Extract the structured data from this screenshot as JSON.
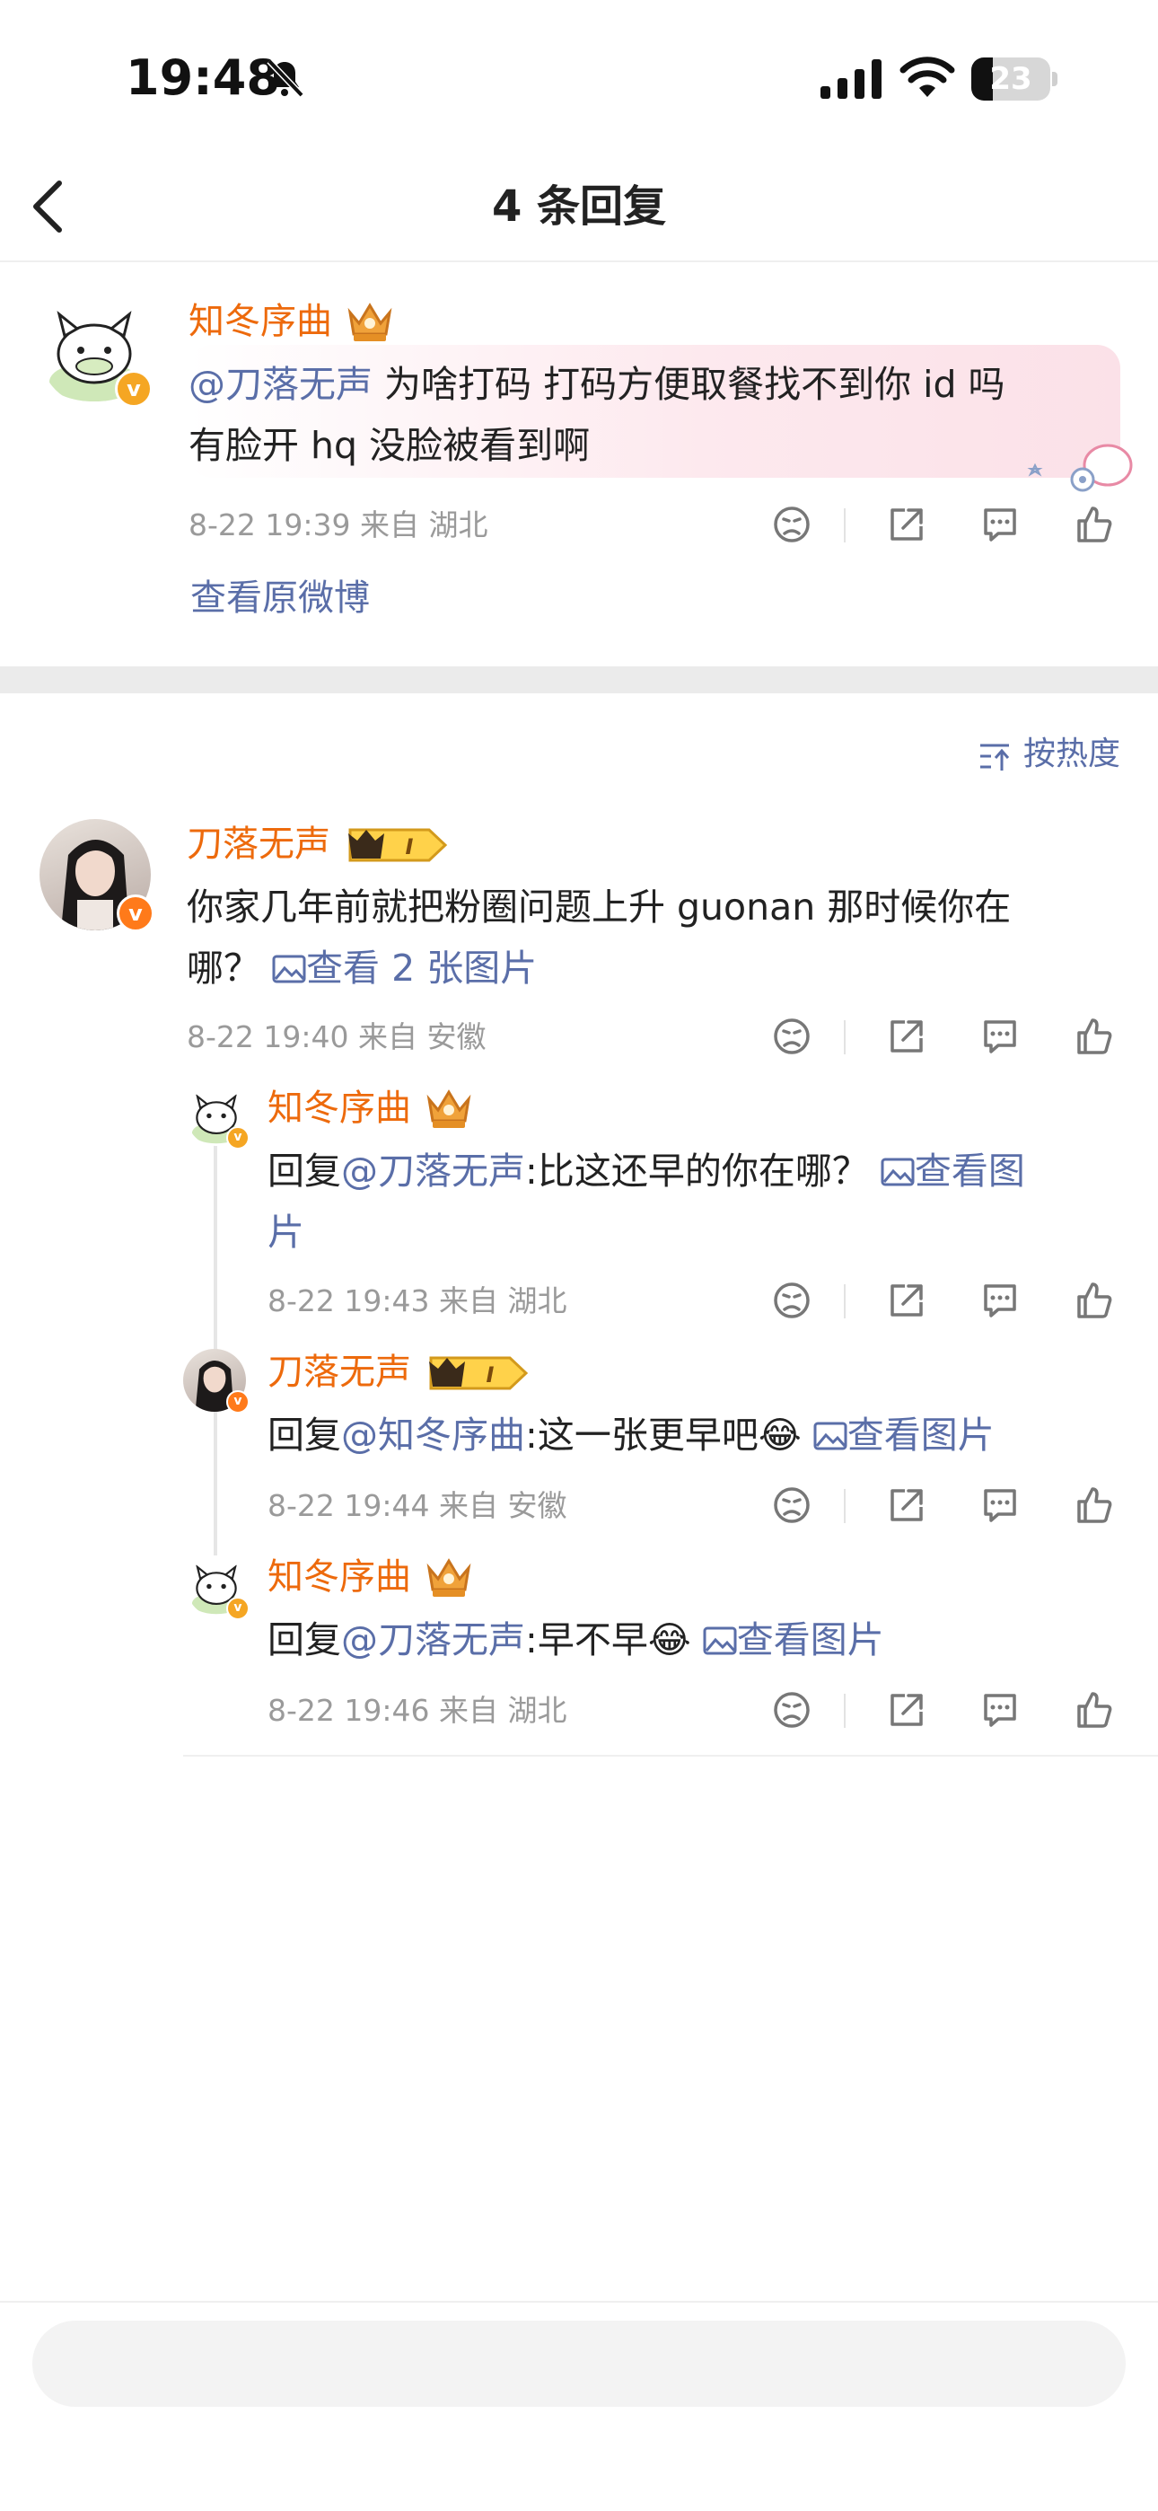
{
  "status_bar": {
    "time": "19:48",
    "battery": "23"
  },
  "nav": {
    "title": "4 条回复"
  },
  "root": {
    "user": "知冬序曲",
    "mention": "@刀落无声",
    "text_line1": " 为啥打码 打码方便取餐找不到你 id 吗",
    "text_line2": "有脸开 hq 没脸被看到啊",
    "meta": "8-22 19:39  来自 湖北",
    "view_original": "查看原微博"
  },
  "sort_label": "按热度",
  "comment": {
    "user": "刀落无声",
    "level": "I",
    "text_line1": "你家几年前就把粉圈问题上升 guonan 那时候你在",
    "text_line2": "哪？",
    "image_link": "查看 2 张图片",
    "meta": "8-22 19:40  来自 安徽"
  },
  "replies": [
    {
      "user": "知冬序曲",
      "prefix": "回复",
      "mention": "@刀落无声",
      "text": ":比这还早的你在哪？",
      "image_link": "查看图",
      "image_link_wrap": "片",
      "meta": "8-22 19:43  来自 湖北"
    },
    {
      "user": "刀落无声",
      "level": "I",
      "prefix": "回复",
      "mention": "@知冬序曲",
      "text": ":这一张更早吧",
      "emoji": "😂",
      "image_link": "查看图片",
      "meta": "8-22 19:44  来自 安徽"
    },
    {
      "user": "知冬序曲",
      "prefix": "回复",
      "mention": "@刀落无声",
      "text": ":早不早",
      "emoji": "😂",
      "image_link": "查看图片",
      "meta": "8-22 19:46  来自 湖北"
    }
  ],
  "colors": {
    "username": "#ed6a0c",
    "link": "#5a6ea8",
    "meta": "#9a9a9a",
    "badge_v": "#f5a623"
  },
  "icons": [
    "bell-slash-icon",
    "signal-icon",
    "wifi-icon",
    "battery-icon",
    "back-chevron-icon",
    "dislike-face-icon",
    "share-icon",
    "comment-icon",
    "like-icon",
    "image-icon",
    "sort-icon",
    "crown-icon"
  ]
}
